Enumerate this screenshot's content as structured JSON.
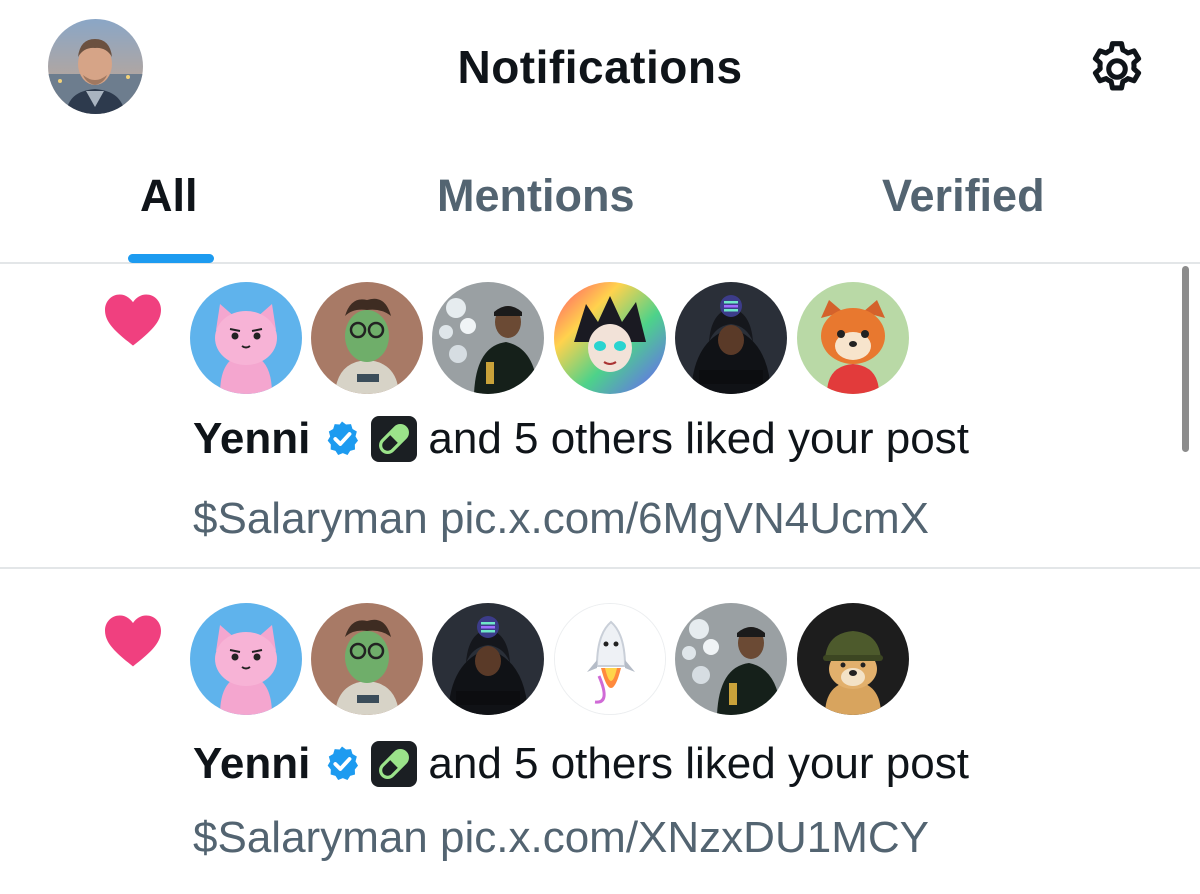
{
  "header": {
    "title": "Notifications",
    "profile_icon": "user-avatar",
    "settings_icon": "gear-icon"
  },
  "tabs": [
    {
      "label": "All",
      "active": true
    },
    {
      "label": "Mentions",
      "active": false
    },
    {
      "label": "Verified",
      "active": false
    }
  ],
  "colors": {
    "accent": "#1d9bf0",
    "heart": "#f91880",
    "secondary_text": "#536471",
    "verified_badge": "#1d9bf0"
  },
  "notifications": [
    {
      "type": "like",
      "icon": "heart-icon",
      "avatars": [
        "pink-cat-avatar",
        "green-character-avatar",
        "champagne-man-avatar",
        "rainbow-anime-avatar",
        "hooded-man-solana-avatar",
        "red-panda-avatar"
      ],
      "name": "Yenni",
      "action": "and 5 others liked your post",
      "post_text": "$Salaryman pic.x.com/6MgVN4UcmX"
    },
    {
      "type": "like",
      "icon": "heart-icon",
      "avatars": [
        "pink-cat-avatar",
        "green-character-avatar",
        "hooded-man-solana-avatar",
        "rocket-avatar",
        "champagne-man-avatar",
        "helmet-dog-avatar"
      ],
      "name": "Yenni",
      "action": "and 5 others liked your post",
      "post_text": "$Salaryman pic.x.com/XNzxDU1MCY"
    }
  ]
}
